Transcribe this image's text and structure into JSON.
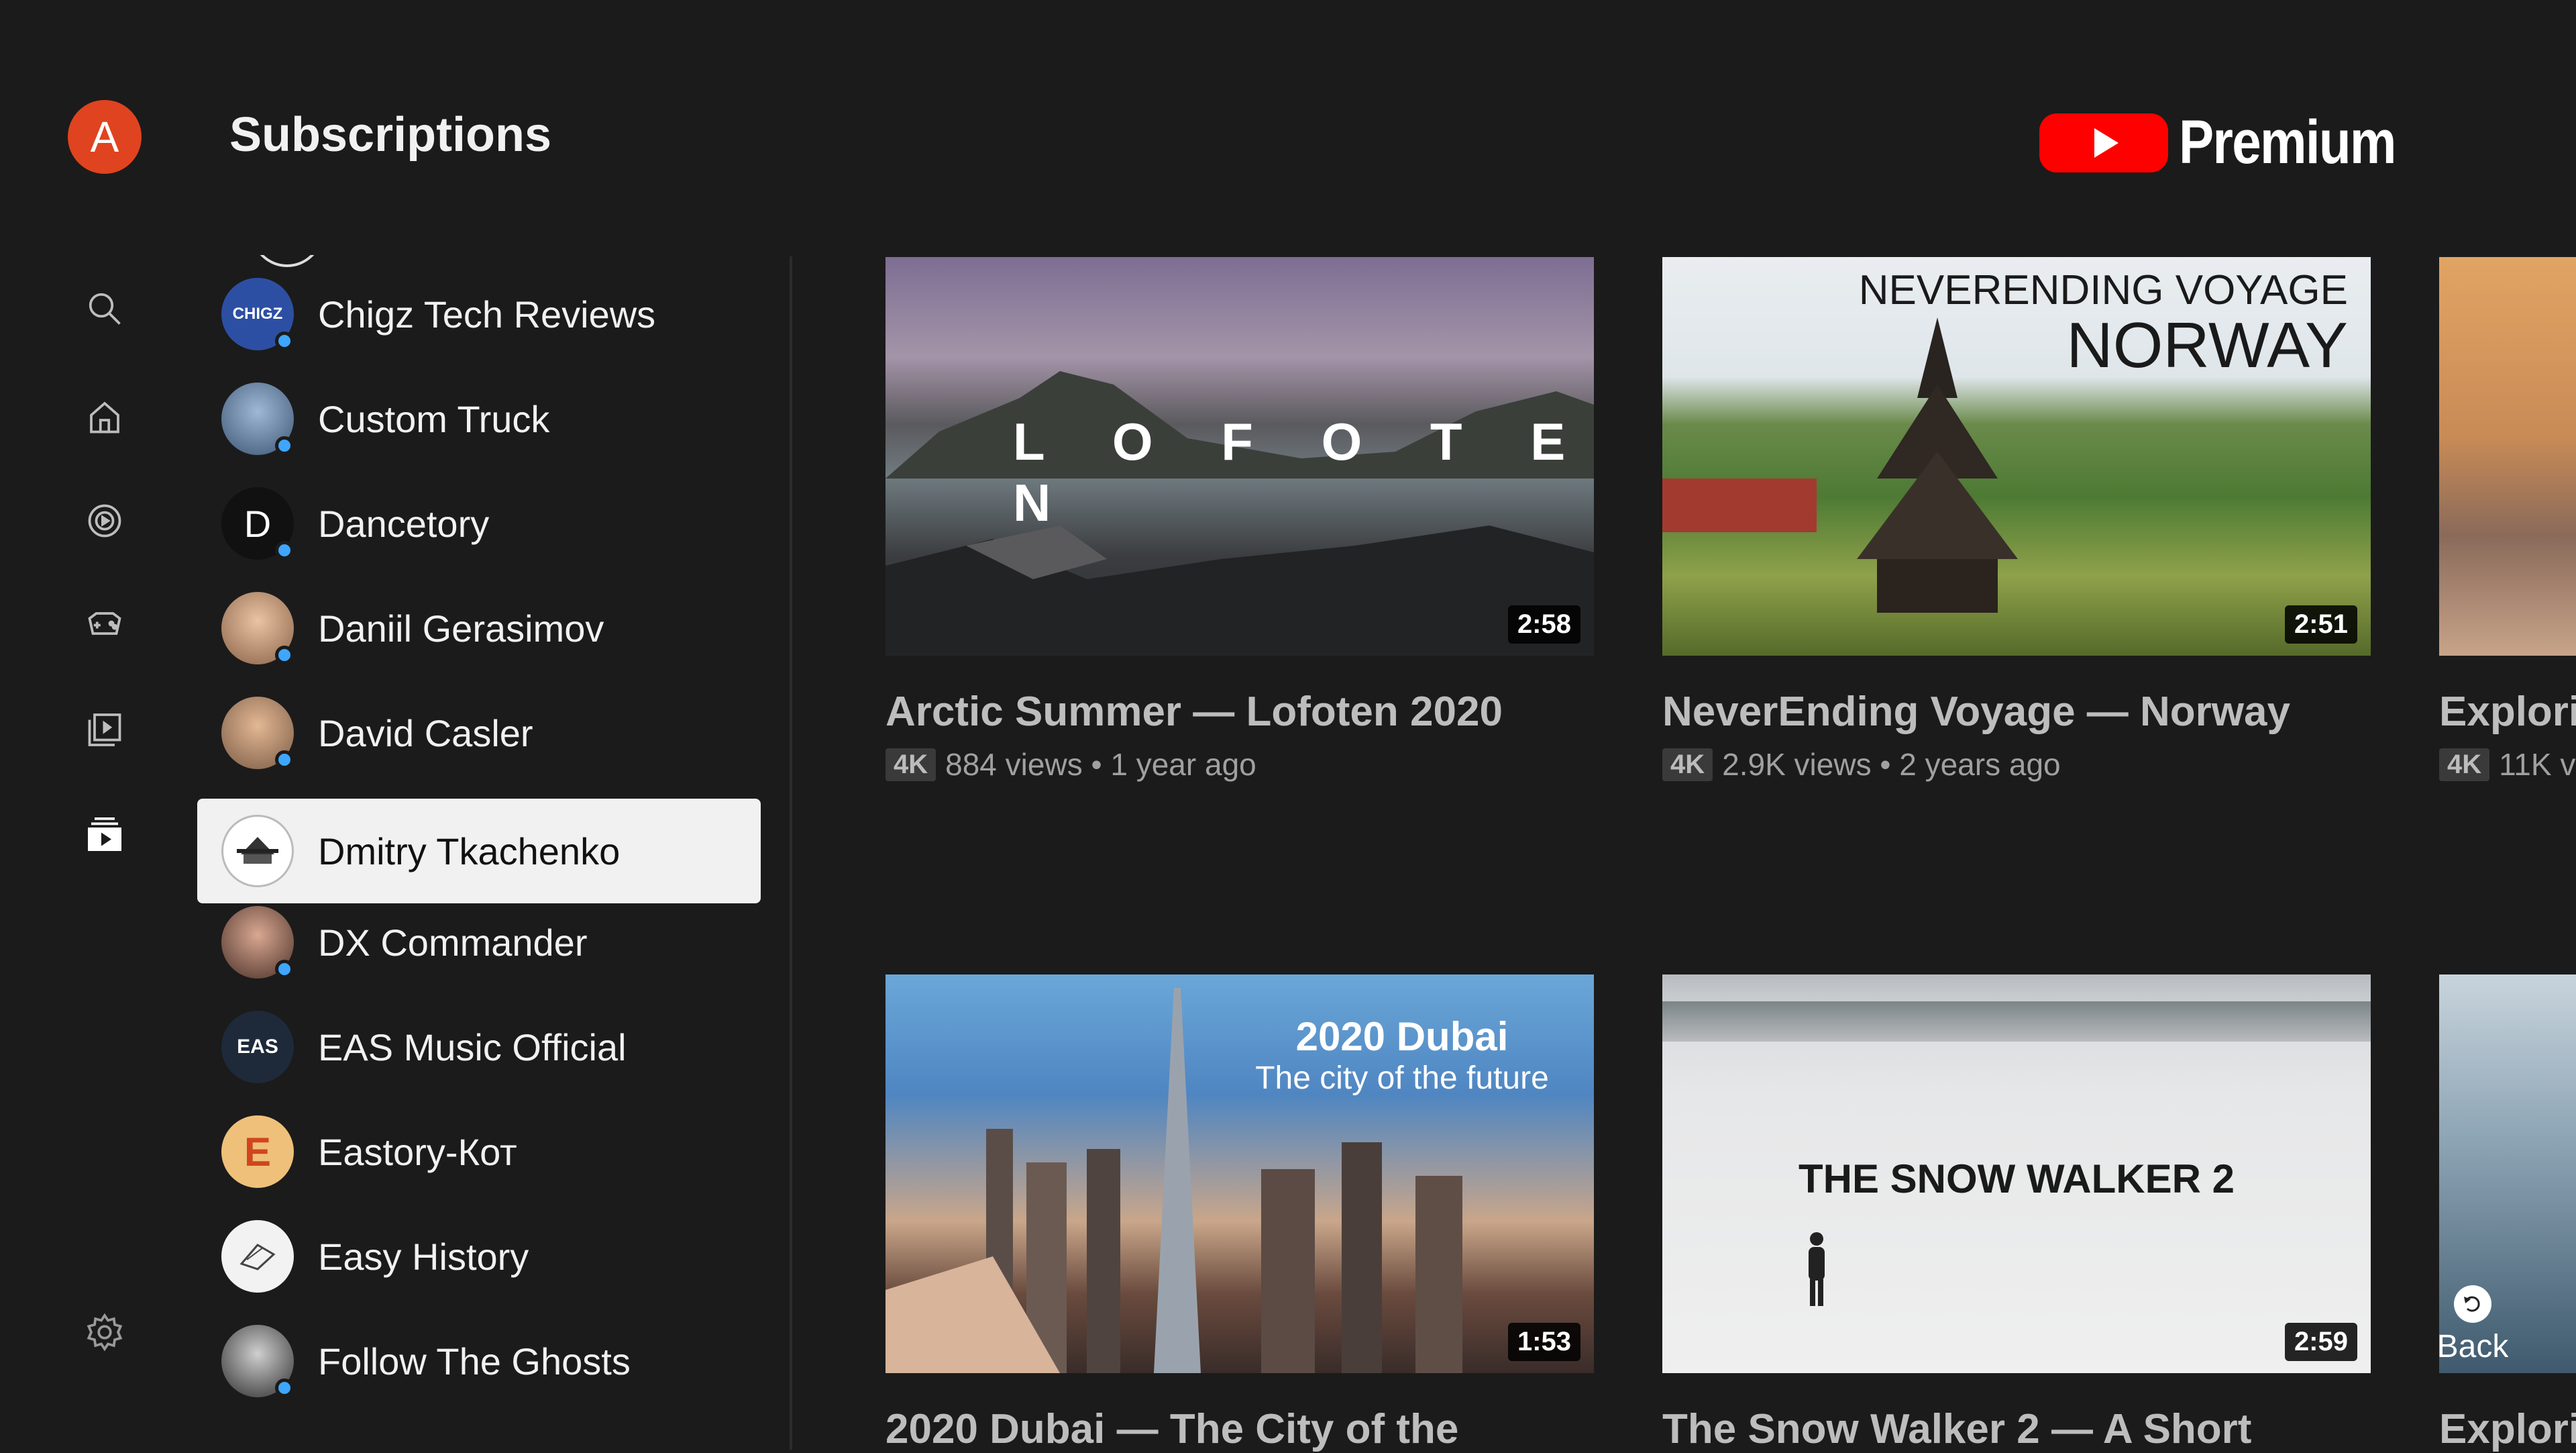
{
  "header": {
    "avatar_letter": "A",
    "title": "Subscriptions",
    "logo_word": "Premium"
  },
  "nav": {
    "icons": [
      "search-icon",
      "home-icon",
      "explore-icon",
      "gaming-icon",
      "library-icon",
      "subscriptions-icon",
      "settings-icon"
    ]
  },
  "channels": [
    {
      "name": "Chigz Tech Reviews",
      "avatar_text": "CHIGZ",
      "avatar_color": "#2d4fa3",
      "new": true
    },
    {
      "name": "Custom Truck",
      "avatar_text": "",
      "avatar_color": "#5b7ea8",
      "new": true
    },
    {
      "name": "Dancetory",
      "avatar_text": "D",
      "avatar_color": "#111111",
      "new": true
    },
    {
      "name": "Daniil Gerasimov",
      "avatar_text": "",
      "avatar_color": "#c79b7a",
      "new": true
    },
    {
      "name": "David Casler",
      "avatar_text": "",
      "avatar_color": "#b98a6a",
      "new": true
    },
    {
      "name": "Dmitry Tkachenko",
      "avatar_text": "",
      "avatar_color": "#d9d9d9",
      "new": false,
      "selected": true
    },
    {
      "name": "DX Commander",
      "avatar_text": "",
      "avatar_color": "#a8786a",
      "new": true
    },
    {
      "name": "EAS Music Official",
      "avatar_text": "EAS",
      "avatar_color": "#1e2a3a",
      "new": false
    },
    {
      "name": "Eastory-Кот",
      "avatar_text": "E",
      "avatar_color": "#e8b46a",
      "new": false
    },
    {
      "name": "Easy History",
      "avatar_text": "",
      "avatar_color": "#f2f2f2",
      "new": false
    },
    {
      "name": "Follow The Ghosts",
      "avatar_text": "",
      "avatar_color": "#6c6c6c",
      "new": true
    }
  ],
  "videos": [
    {
      "title": "Arctic Summer — Lofoten 2020",
      "badge": "4K",
      "meta": "884 views • 1 year ago",
      "duration": "2:58",
      "overlay": "L O F O T E N"
    },
    {
      "title": "NeverEnding Voyage — Norway",
      "badge": "4K",
      "meta": "2.9K views • 2 years ago",
      "duration": "2:51",
      "overlay_line1": "NEVERENDING VOYAGE",
      "overlay_line2": "NORWAY"
    },
    {
      "title": "Explori",
      "badge": "4K",
      "meta": "11K v"
    },
    {
      "title": "2020 Dubai — The City of the",
      "duration": "1:53",
      "overlay_line1": "2020 Dubai",
      "overlay_line2": "The city of the future"
    },
    {
      "title": "The Snow Walker 2 — A Short",
      "duration": "2:59",
      "overlay": "THE SNOW WALKER 2"
    },
    {
      "title": "Explori"
    }
  ],
  "back_hint": {
    "label": "Back"
  },
  "colors": {
    "accent": "#ff0000",
    "background": "#1b1b1b",
    "new_dot": "#3ea6ff",
    "selected_bg": "#f1f1f1"
  }
}
